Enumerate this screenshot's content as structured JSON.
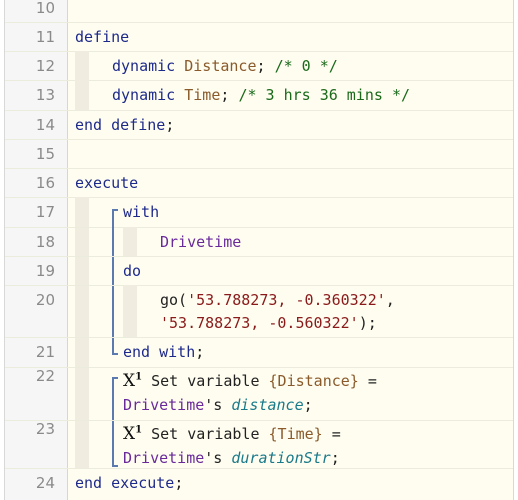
{
  "lines": [
    {
      "num": "10"
    },
    {
      "num": "11",
      "kw": "define"
    },
    {
      "num": "12",
      "kw": "dynamic",
      "var": "Distance",
      "sep": ";",
      "cmt": "/* 0 */"
    },
    {
      "num": "13",
      "kw": "dynamic",
      "var": "Time",
      "sep": ";",
      "cmt": "/* 3 hrs 36 mins */"
    },
    {
      "num": "14",
      "kw": "end define",
      "sep": ";"
    },
    {
      "num": "15"
    },
    {
      "num": "16",
      "kw": "execute"
    },
    {
      "num": "17",
      "kw": "with"
    },
    {
      "num": "18",
      "fn": "Drivetime"
    },
    {
      "num": "19",
      "kw": "do"
    },
    {
      "num": "20",
      "call": "go(",
      "str1": "'53.788273, -0.360322'",
      "comma": ",",
      "str2": "'53.788273, -0.560322'",
      "close": ");"
    },
    {
      "num": "21",
      "kw": "end with",
      "sep": ";"
    },
    {
      "num": "22",
      "icon": "X",
      "sup": "1",
      "text": "Set variable ",
      "var": "{Distance}",
      "eq": " =",
      "fn": "Drivetime",
      "poss": "'s ",
      "prop": "distance",
      "sep": ";"
    },
    {
      "num": "23",
      "icon": "X",
      "sup": "1",
      "text": "Set variable ",
      "var": "{Time}",
      "eq": " =",
      "fn": "Drivetime",
      "poss": "'s ",
      "prop": "durationStr",
      "sep": ";"
    },
    {
      "num": "24",
      "kw": "end execute",
      "sep": ";"
    }
  ]
}
